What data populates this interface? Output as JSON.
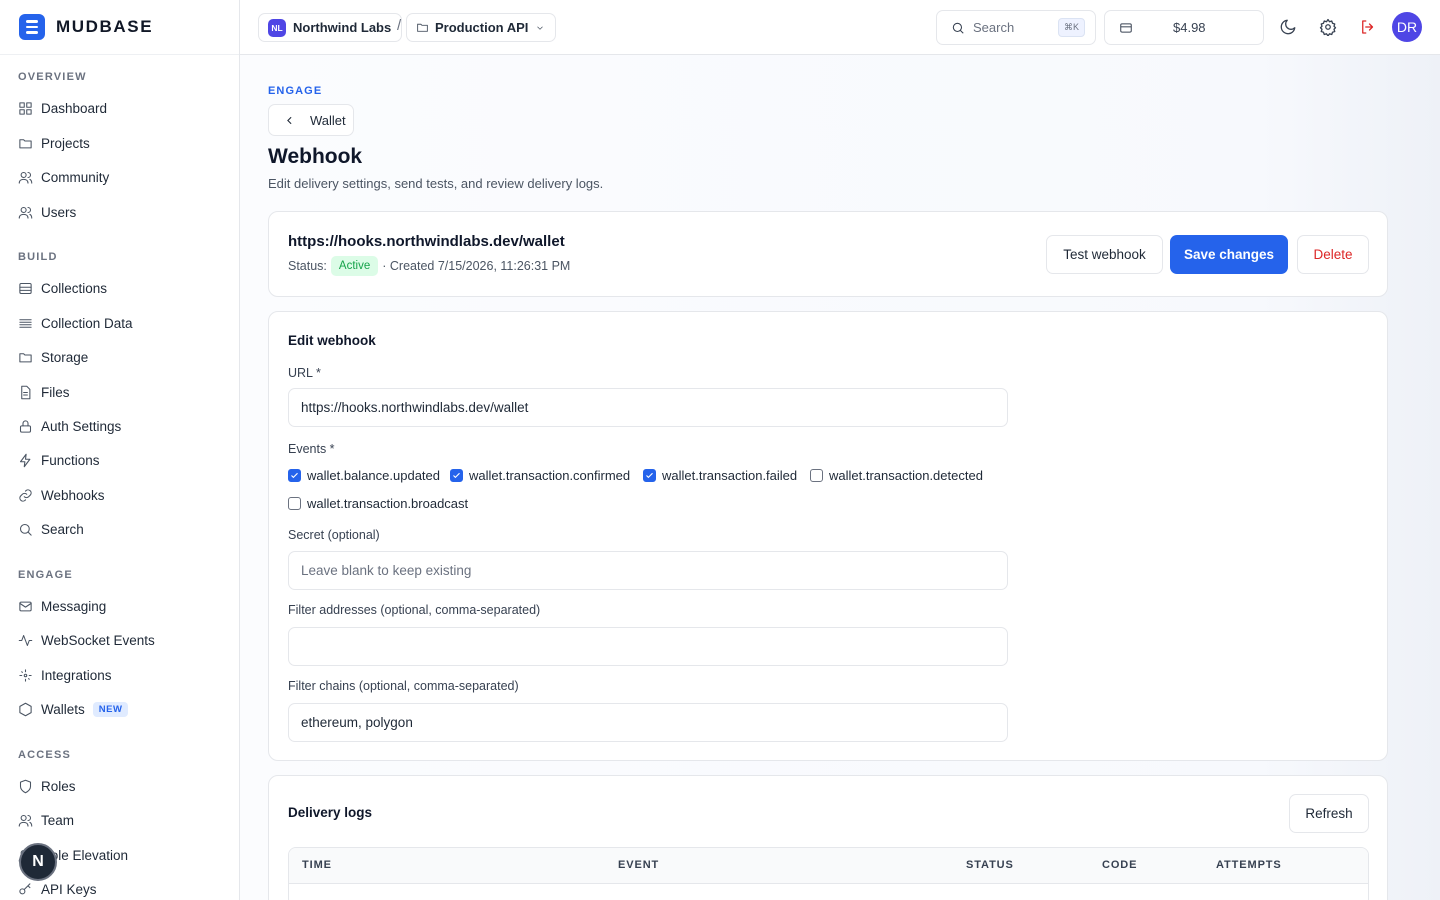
{
  "brand": {
    "name": "MUDBASE"
  },
  "sidebar": {
    "sections": [
      {
        "title": "OVERVIEW",
        "items": [
          {
            "label": "Dashboard",
            "icon": "grid-icon"
          },
          {
            "label": "Projects",
            "icon": "folder-icon"
          },
          {
            "label": "Community",
            "icon": "users-icon"
          },
          {
            "label": "Users",
            "icon": "users-icon"
          }
        ]
      },
      {
        "title": "BUILD",
        "items": [
          {
            "label": "Collections",
            "icon": "database-icon"
          },
          {
            "label": "Collection Data",
            "icon": "list-icon"
          },
          {
            "label": "Storage",
            "icon": "folder-icon"
          },
          {
            "label": "Files",
            "icon": "file-icon"
          },
          {
            "label": "Auth Settings",
            "icon": "lock-icon"
          },
          {
            "label": "Functions",
            "icon": "bolt-icon"
          },
          {
            "label": "Webhooks",
            "icon": "link-icon"
          },
          {
            "label": "Search",
            "icon": "search-icon"
          }
        ]
      },
      {
        "title": "ENGAGE",
        "items": [
          {
            "label": "Messaging",
            "icon": "mail-icon"
          },
          {
            "label": "WebSocket Events",
            "icon": "activity-icon"
          },
          {
            "label": "Integrations",
            "icon": "integrations-icon"
          },
          {
            "label": "Wallets",
            "icon": "hexagon-icon",
            "badge": "NEW"
          }
        ]
      },
      {
        "title": "ACCESS",
        "items": [
          {
            "label": "Roles",
            "icon": "shield-icon"
          },
          {
            "label": "Team",
            "icon": "users-icon"
          },
          {
            "label": "Role Elevation",
            "icon": "users-icon"
          },
          {
            "label": "API Keys",
            "icon": "key-icon"
          }
        ]
      }
    ],
    "help_badge": "N"
  },
  "topbar": {
    "org": {
      "initials": "NL",
      "name": "Northwind Labs"
    },
    "separator": "/",
    "project": {
      "name": "Production API"
    },
    "search": {
      "placeholder": "Search",
      "shortcut": "⌘K"
    },
    "balance": "$4.98",
    "avatar_initials": "DR"
  },
  "page": {
    "eyebrow": "ENGAGE",
    "back_label": "Wallet",
    "title": "Webhook",
    "subtitle": "Edit delivery settings, send tests, and review delivery logs."
  },
  "summary": {
    "url": "https://hooks.northwindlabs.dev/wallet",
    "status_label": "Status:",
    "status": "Active",
    "created": "· Created 7/15/2026, 11:26:31 PM",
    "test_label": "Test webhook",
    "save_label": "Save changes",
    "delete_label": "Delete"
  },
  "edit": {
    "title": "Edit webhook",
    "url_label": "URL *",
    "url_value": "https://hooks.northwindlabs.dev/wallet",
    "events_label": "Events *",
    "events": [
      {
        "label": "wallet.balance.updated",
        "checked": true
      },
      {
        "label": "wallet.transaction.confirmed",
        "checked": true
      },
      {
        "label": "wallet.transaction.failed",
        "checked": true
      },
      {
        "label": "wallet.transaction.detected",
        "checked": false
      },
      {
        "label": "wallet.transaction.broadcast",
        "checked": false
      }
    ],
    "secret_label": "Secret (optional)",
    "secret_placeholder": "Leave blank to keep existing",
    "addresses_label": "Filter addresses (optional, comma-separated)",
    "addresses_value": "",
    "chains_label": "Filter chains (optional, comma-separated)",
    "chains_value": "ethereum, polygon"
  },
  "logs": {
    "title": "Delivery logs",
    "refresh_label": "Refresh",
    "columns": [
      "TIME",
      "EVENT",
      "STATUS",
      "CODE",
      "ATTEMPTS"
    ]
  },
  "colors": {
    "accent": "#2563eb",
    "active_bg": "#dcfce7",
    "active_text": "#16a34a",
    "danger": "#dc2626"
  }
}
